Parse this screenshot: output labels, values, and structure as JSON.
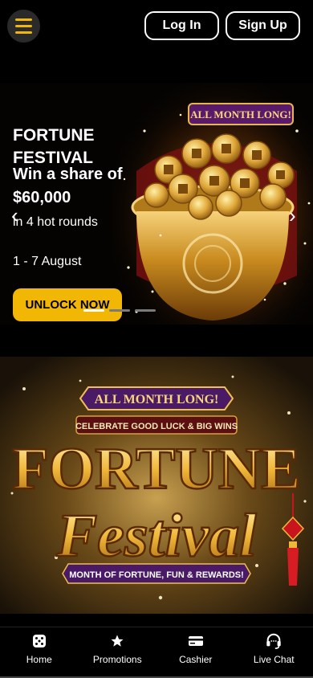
{
  "header": {
    "menu_icon": "hamburger-icon",
    "login_label": "Log In",
    "signup_label": "Sign Up",
    "accent_color": "#f2b705"
  },
  "hero": {
    "title": "FORTUNE FESTIVAL",
    "headline": "Win a share of $60,000",
    "subtitle": "in 4 hot rounds",
    "date": "1 - 7 August",
    "cta_label": "UNLOCK NOW",
    "badge": "ALL MONTH LONG!",
    "slide_count": 3,
    "active_slide": 1
  },
  "promo": {
    "badge": "ALL MONTH LONG!",
    "tagline": "CELEBRATE GOOD LUCK & BIG WINS",
    "title_line1": "FORTUNE",
    "title_line2": "Festival",
    "footer": "MONTH OF FORTUNE, FUN & REWARDS!"
  },
  "bottom_nav": {
    "items": [
      {
        "label": "Home",
        "icon": "dice-icon"
      },
      {
        "label": "Promotions",
        "icon": "star-icon"
      },
      {
        "label": "Cashier",
        "icon": "credit-card-icon"
      },
      {
        "label": "Live Chat",
        "icon": "headset-icon"
      }
    ]
  }
}
